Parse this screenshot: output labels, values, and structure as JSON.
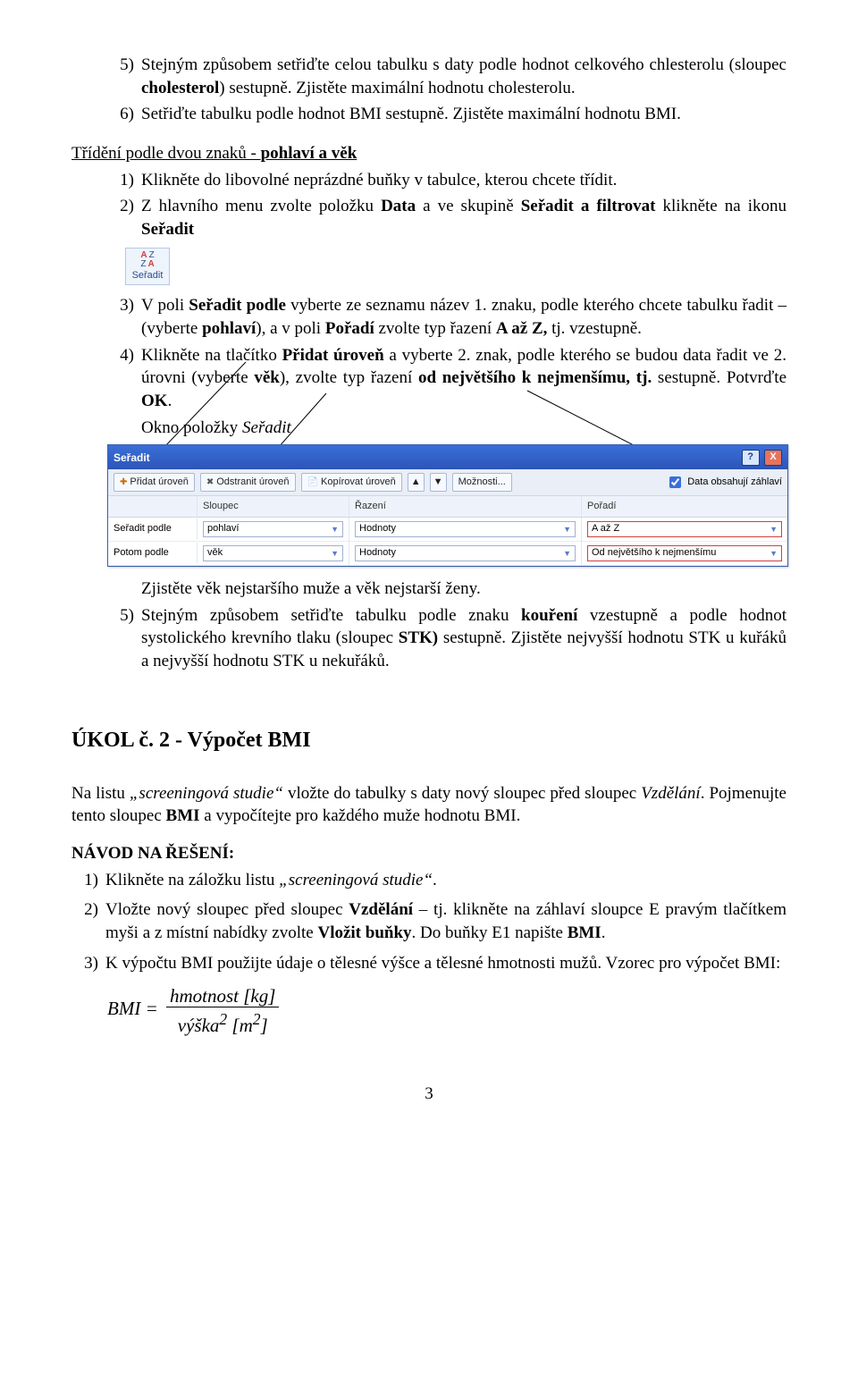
{
  "top": {
    "item5": "Stejným způsobem setřiďte celou tabulku s daty podle hodnot celkového chlesterolu (sloupec cholesterol) sestupně. Zjistěte maximální hodnotu cholesterolu.",
    "item6": "Setřiďte tabulku podle hodnot BMI sestupně. Zjistěte maximální hodnotu BMI.",
    "n5": "5)",
    "n6": "6)"
  },
  "section_heading": "Třídění podle dvou znaků - pohlaví a věk",
  "sort_steps": {
    "n1": "1)",
    "t1": "Klikněte do libovolné neprázdné buňky v tabulce, kterou chcete třídit.",
    "n2": "2)",
    "t2": "Z hlavního menu zvolte položku Data a ve skupině Seřadit a filtrovat klikněte na ikonu Seřadit"
  },
  "sort_icon_label": "Seřadit",
  "mid": {
    "n3": "3)",
    "t3": "V poli Seřadit podle vyberte ze seznamu název 1. znaku, podle kterého chcete tabulku řadit – (vyberte pohlaví), a v poli Pořadí zvolte typ řazení A až Z, tj. vzestupně.",
    "n4": "4)",
    "t4a": "Klikněte na tlačítko Přidat úroveň a vyberte 2. znak, podle kterého se budou data řadit ve 2. úrovni (vyberte věk), zvolte typ řazení od největšího k nejmenšímu, tj. sestupně. Potvrďte OK.",
    "caption": "Okno položky Seřadit"
  },
  "dialog": {
    "title": "Seřadit",
    "help": "?",
    "close": "X",
    "btn_add": "Přidat úroveň",
    "btn_del": "Odstranit úroveň",
    "btn_copy": "Kopírovat úroveň",
    "btn_opt": "Možnosti...",
    "chk": "Data obsahují záhlaví",
    "col_head": "Sloupec",
    "sort_head": "Řazení",
    "ord_head": "Pořadí",
    "row1_lbl": "Seřadit podle",
    "row2_lbl": "Potom podle",
    "r1_col": "pohlaví",
    "r1_sort": "Hodnoty",
    "r1_ord": "A až Z",
    "r2_col": "věk",
    "r2_sort": "Hodnoty",
    "r2_ord": "Od největšího k nejmenšímu"
  },
  "after": {
    "line": "Zjistěte věk nejstaršího muže a věk nejstarší ženy.",
    "n5": "5)",
    "t5": "Stejným způsobem setřiďte tabulku podle znaku kouření vzestupně a podle hodnot systolického krevního tlaku (sloupec STK) sestupně. Zjistěte nejvyšší hodnotu STK u kuřáků a nejvyšší hodnotu STK u nekuřáků."
  },
  "task2_heading": "ÚKOL č. 2 - Výpočet BMI",
  "task2_intro": "Na listu „screeningová studie“ vložte do tabulky s daty nový sloupec před sloupec Vzdělání. Pojmenujte tento sloupec BMI a vypočítejte pro každého muže hodnotu BMI.",
  "navod": "NÁVOD NA ŘEŠENÍ:",
  "steps2": {
    "n1": "1)",
    "t1": "Klikněte na záložku listu „screeningová studie“.",
    "n2": "2)",
    "t2": "Vložte nový sloupec před sloupec Vzdělání – tj. klikněte na záhlaví sloupce E pravým tlačítkem myši a z místní nabídky zvolte Vložit buňky. Do buňky E1 napište BMI.",
    "n3": "3)",
    "t3": "K výpočtu BMI použijte údaje o tělesné výšce a tělesné hmotnosti mužů. Vzorec pro výpočet BMI:"
  },
  "formula": {
    "lhs": "BMI",
    "eq": "=",
    "num": "hmotnost [kg]",
    "den": "výška² [m²]"
  },
  "page": "3"
}
